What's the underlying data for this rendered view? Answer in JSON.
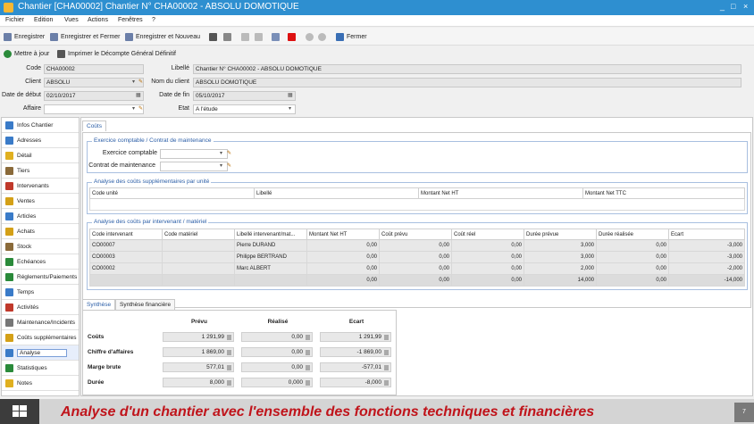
{
  "window": {
    "title": "Chantier [CHA00002] Chantier N° CHA00002 - ABSOLU DOMOTIQUE",
    "controls": [
      "_",
      "□",
      "×"
    ]
  },
  "menu": [
    "Fichier",
    "Edition",
    "Vues",
    "Actions",
    "Fenêtres",
    "?"
  ],
  "toolbar": {
    "enregistrer": "Enregistrer",
    "enregistrer_fermer": "Enregistrer et Fermer",
    "enregistrer_nouveau": "Enregistrer et Nouveau",
    "fermer": "Fermer"
  },
  "actions": {
    "mettre_a_jour": "Mettre à jour",
    "imprimer": "Imprimer le Décompte Général Définitif"
  },
  "form": {
    "code_label": "Code",
    "code": "CHA00002",
    "libelle_label": "Libellé",
    "libelle": "Chantier N° CHA00002 - ABSOLU DOMOTIQUE",
    "client_label": "Client",
    "client": "ABSOLU",
    "nom_client_label": "Nom du client",
    "nom_client": "ABSOLU DOMOTIQUE",
    "date_debut_label": "Date de début",
    "date_debut": "02/10/2017",
    "date_fin_label": "Date de fin",
    "date_fin": "05/10/2017",
    "affaire_label": "Affaire",
    "affaire": "",
    "etat_label": "Etat",
    "etat": "A l'étude"
  },
  "sidebar": [
    "Infos Chantier",
    "Adresses",
    "Détail",
    "Tiers",
    "Intervenants",
    "Ventes",
    "Articles",
    "Achats",
    "Stock",
    "Echéances",
    "Réglements/Paiements",
    "Temps",
    "Activités",
    "Maintenance/Incidents",
    "Coûts supplémentaires",
    "Analyse",
    "Statistiques",
    "Notes"
  ],
  "tabs": {
    "couts": "Coûts",
    "synthese": "Synthèse",
    "synthese_fin": "Synthèse financière"
  },
  "exercice": {
    "title": "Exercice comptable / Contrat de maintenance",
    "exercice_label": "Exercice comptable",
    "contrat_label": "Contrat de maintenance"
  },
  "couts_sup": {
    "title": "Analyse des coûts supplémentaires par unité",
    "headers": [
      "Code unité",
      "Libellé",
      "Montant Net HT",
      "Montant Net TTC"
    ]
  },
  "couts_interv": {
    "title": "Analyse des coûts par intervenant / matériel",
    "headers": [
      "Code intervenant",
      "Code matériel",
      "Libellé intervenant/mat...",
      "Montant Net HT",
      "Coût prévu",
      "Coût réel",
      "Durée prévue",
      "Durée réalisée",
      "Ecart"
    ],
    "rows": [
      [
        "CO00007",
        "",
        "Pierre DURAND",
        "0,00",
        "0,00",
        "0,00",
        "3,000",
        "0,00",
        "-3,000"
      ],
      [
        "CO00003",
        "",
        "Philippe BERTRAND",
        "0,00",
        "0,00",
        "0,00",
        "3,000",
        "0,00",
        "-3,000"
      ],
      [
        "CO00002",
        "",
        "Marc ALBERT",
        "0,00",
        "0,00",
        "0,00",
        "2,000",
        "0,00",
        "-2,000"
      ]
    ],
    "total": [
      "",
      "",
      "",
      "0,00",
      "0,00",
      "0,00",
      "14,000",
      "0,00",
      "-14,000"
    ]
  },
  "synthese": {
    "cols": [
      "Prévu",
      "Réalisé",
      "Ecart"
    ],
    "rows": [
      {
        "label": "Coûts",
        "values": [
          "1 291,99",
          "0,00",
          "1 291,99"
        ]
      },
      {
        "label": "Chiffre d'affaires",
        "values": [
          "1 869,00",
          "0,00",
          "-1 869,00"
        ]
      },
      {
        "label": "Marge brute",
        "values": [
          "577,01",
          "0,00",
          "-577,01"
        ]
      },
      {
        "label": "Durée",
        "values": [
          "8,000",
          "0,000",
          "-8,000"
        ]
      }
    ]
  },
  "caption": "Analyse d'un chantier avec l'ensemble des fonctions techniques et financières",
  "taskbar_badge": "7"
}
